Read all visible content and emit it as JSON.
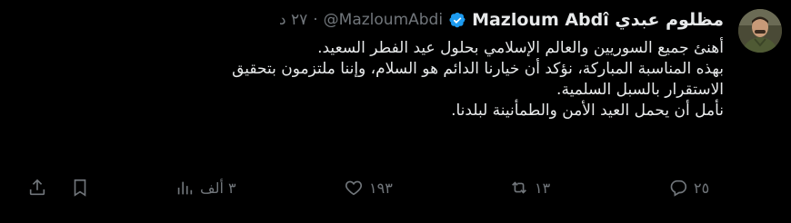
{
  "tweet": {
    "author_name": "Mazloum Abdî مظلوم عبدي",
    "handle": "@MazloumAbdi",
    "separator": "·",
    "time": "٢٧ د",
    "lines": [
      "أهنئ جميع السوريين والعالم الإسلامي بحلول عيد الفطر السعيد.",
      "بهذه المناسبة المباركة، نؤكد أن خيارنا الدائم هو السلام، وإننا ملتزمون بتحقيق",
      "الاستقرار بالسبل السلمية.",
      "نأمل أن يحمل العيد الأمن والطمأنينة لبلدنا."
    ],
    "actions": {
      "reply_count": "٢٥",
      "retweet_count": "١٣",
      "like_count": "١٩٣",
      "views_count": "٣ ألف"
    }
  },
  "icons": {
    "verified": "verified-badge-icon",
    "reply": "reply-icon",
    "retweet": "retweet-icon",
    "like": "heart-icon",
    "views": "views-chart-icon",
    "bookmark": "bookmark-icon",
    "share": "share-icon"
  },
  "colors": {
    "background": "#000000",
    "text": "#e7e9ea",
    "muted": "#71767b",
    "verified": "#1d9bf0"
  }
}
